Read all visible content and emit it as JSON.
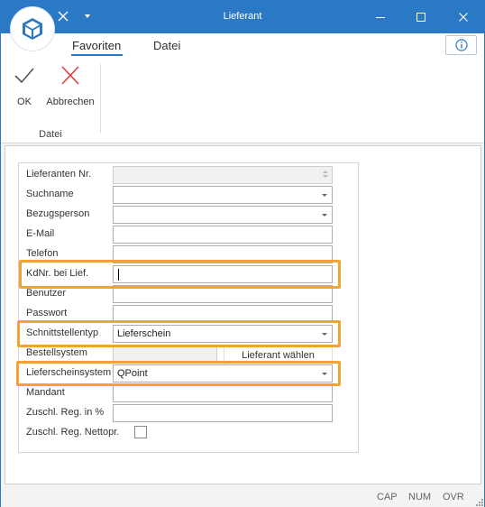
{
  "window": {
    "title": "Lieferant",
    "accent_color": "#2b79c4",
    "highlight_color": "#f5a233"
  },
  "titlebar": {
    "logo_icon": "cube-icon",
    "quick_access": [
      "close-x-icon",
      "dropdown-arrow-icon"
    ],
    "controls": [
      "minimize-icon",
      "maximize-icon",
      "close-icon"
    ]
  },
  "ribbon": {
    "tabs": [
      {
        "label": "Favoriten",
        "active": true
      },
      {
        "label": "Datei",
        "active": false
      }
    ],
    "info_icon": "info-icon",
    "buttons": [
      {
        "label": "OK",
        "icon": "checkmark-icon"
      },
      {
        "label": "Abbrechen",
        "icon": "x-cross-icon"
      }
    ],
    "group_label": "Datei"
  },
  "form": {
    "fields": [
      {
        "label": "Lieferanten Nr.",
        "value": "",
        "type": "spin",
        "disabled": true
      },
      {
        "label": "Suchname",
        "value": "",
        "type": "combo"
      },
      {
        "label": "Bezugsperson",
        "value": "",
        "type": "combo"
      },
      {
        "label": "E-Mail",
        "value": "",
        "type": "text"
      },
      {
        "label": "Telefon",
        "value": "",
        "type": "text"
      },
      {
        "label": "KdNr. bei Lief.",
        "value": "",
        "type": "text",
        "highlighted": true,
        "focused": true
      },
      {
        "label": "Benutzer",
        "value": "",
        "type": "text"
      },
      {
        "label": "Passwort",
        "value": "",
        "type": "text"
      },
      {
        "label": "Schnittstellentyp",
        "value": "Lieferschein",
        "type": "combo",
        "highlighted": true
      },
      {
        "label": "Bestellsystem",
        "value": "",
        "type": "text",
        "disabled": true
      },
      {
        "label": "Lieferscheinsystem",
        "value": "QPoint",
        "type": "combo",
        "highlighted": true
      },
      {
        "label": "Mandant",
        "value": "",
        "type": "text"
      },
      {
        "label": "Zuschl. Reg. in %",
        "value": "",
        "type": "text"
      },
      {
        "label": "Zuschl. Reg. Nettopr.",
        "checked": false,
        "type": "checkbox"
      }
    ],
    "pick_button_label": "Lieferant wählen"
  },
  "statusbar": {
    "cap": "CAP",
    "num": "NUM",
    "ovr": "OVR"
  }
}
